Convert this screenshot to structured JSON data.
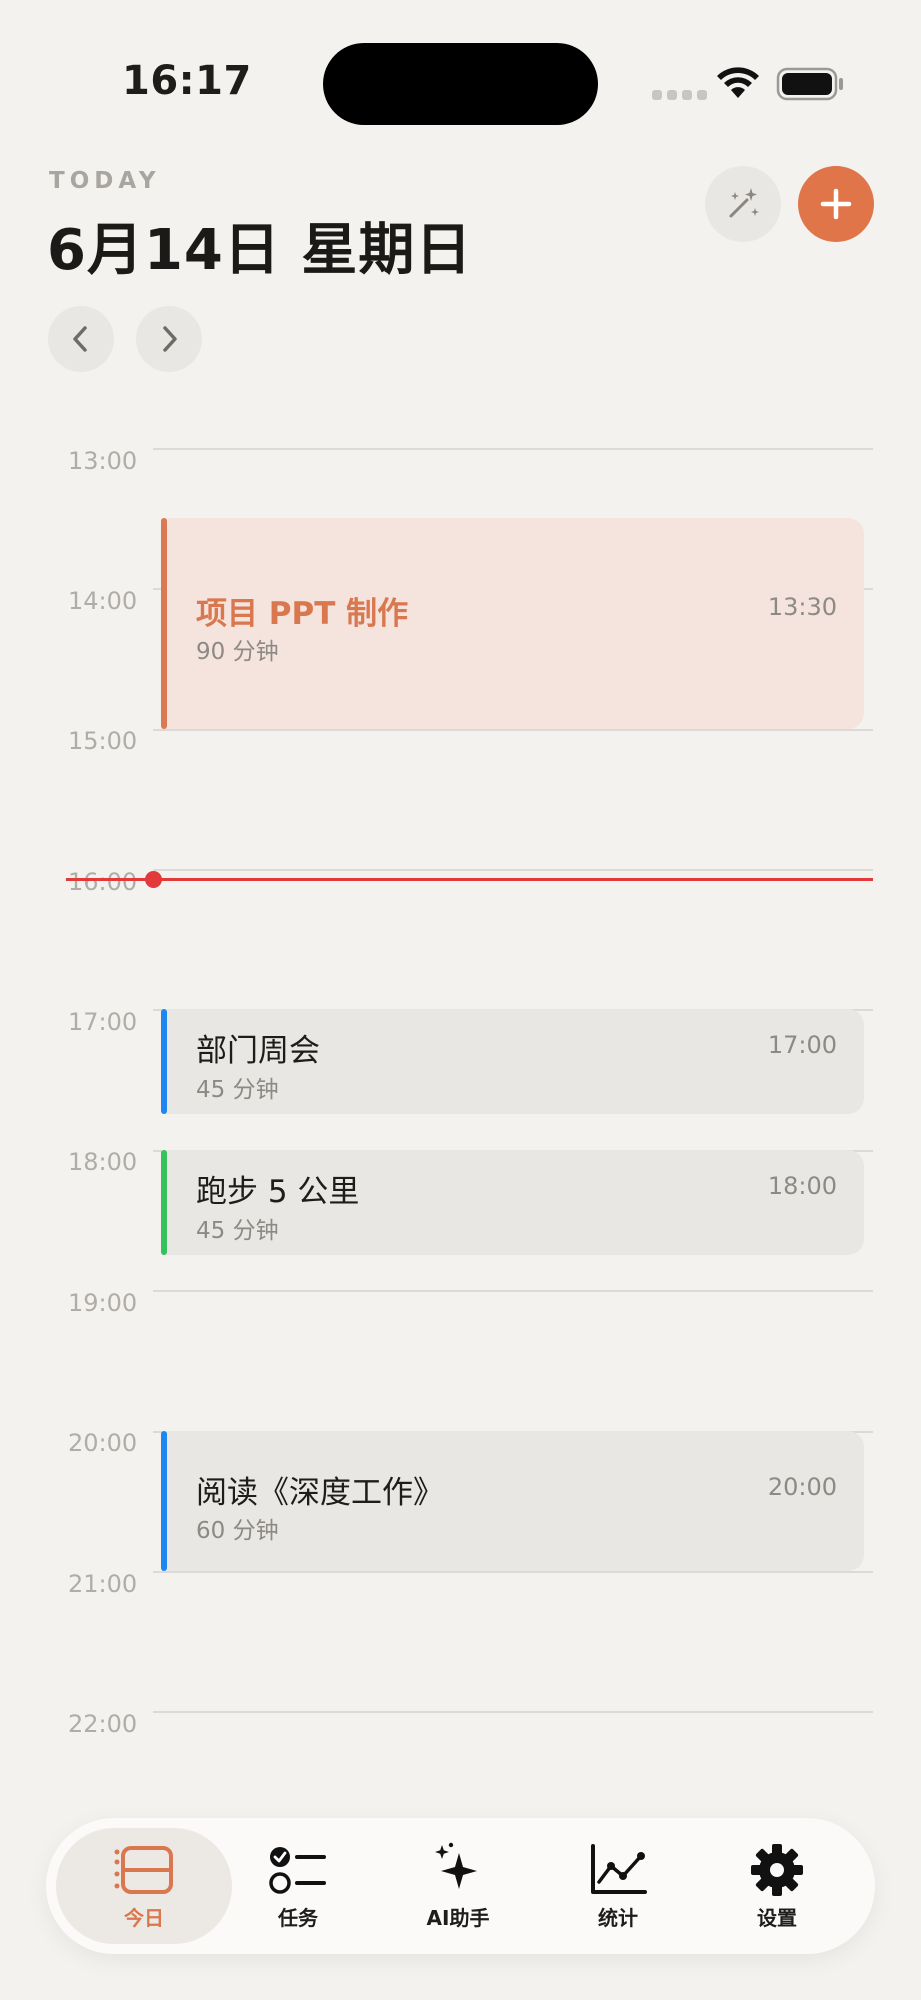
{
  "status_bar": {
    "time": "16:17"
  },
  "header": {
    "today_label": "TODAY",
    "date_title": "6月14日 星期日"
  },
  "timeline": {
    "hours": [
      "13:00",
      "14:00",
      "15:00",
      "16:00",
      "17:00",
      "18:00",
      "19:00",
      "20:00",
      "21:00",
      "22:00"
    ],
    "events": [
      {
        "title": "项目 PPT 制作",
        "duration": "90 分钟",
        "time": "13:30",
        "color": "#d97a53"
      },
      {
        "title": "部门周会",
        "duration": "45 分钟",
        "time": "17:00",
        "color": "#1d86f0"
      },
      {
        "title": "跑步 5 公里",
        "duration": "45 分钟",
        "time": "18:00",
        "color": "#33c35a"
      },
      {
        "title": "阅读《深度工作》",
        "duration": "60 分钟",
        "time": "20:00",
        "color": "#1d86f0"
      }
    ]
  },
  "tabs": [
    {
      "label": "今日",
      "icon": "today-icon",
      "active": true
    },
    {
      "label": "任务",
      "icon": "tasks-icon"
    },
    {
      "label": "AI助手",
      "icon": "sparkles-icon"
    },
    {
      "label": "统计",
      "icon": "chart-icon"
    },
    {
      "label": "设置",
      "icon": "gear-icon"
    }
  ],
  "colors": {
    "accent": "#df7549",
    "now_line": "#e23a3a"
  }
}
